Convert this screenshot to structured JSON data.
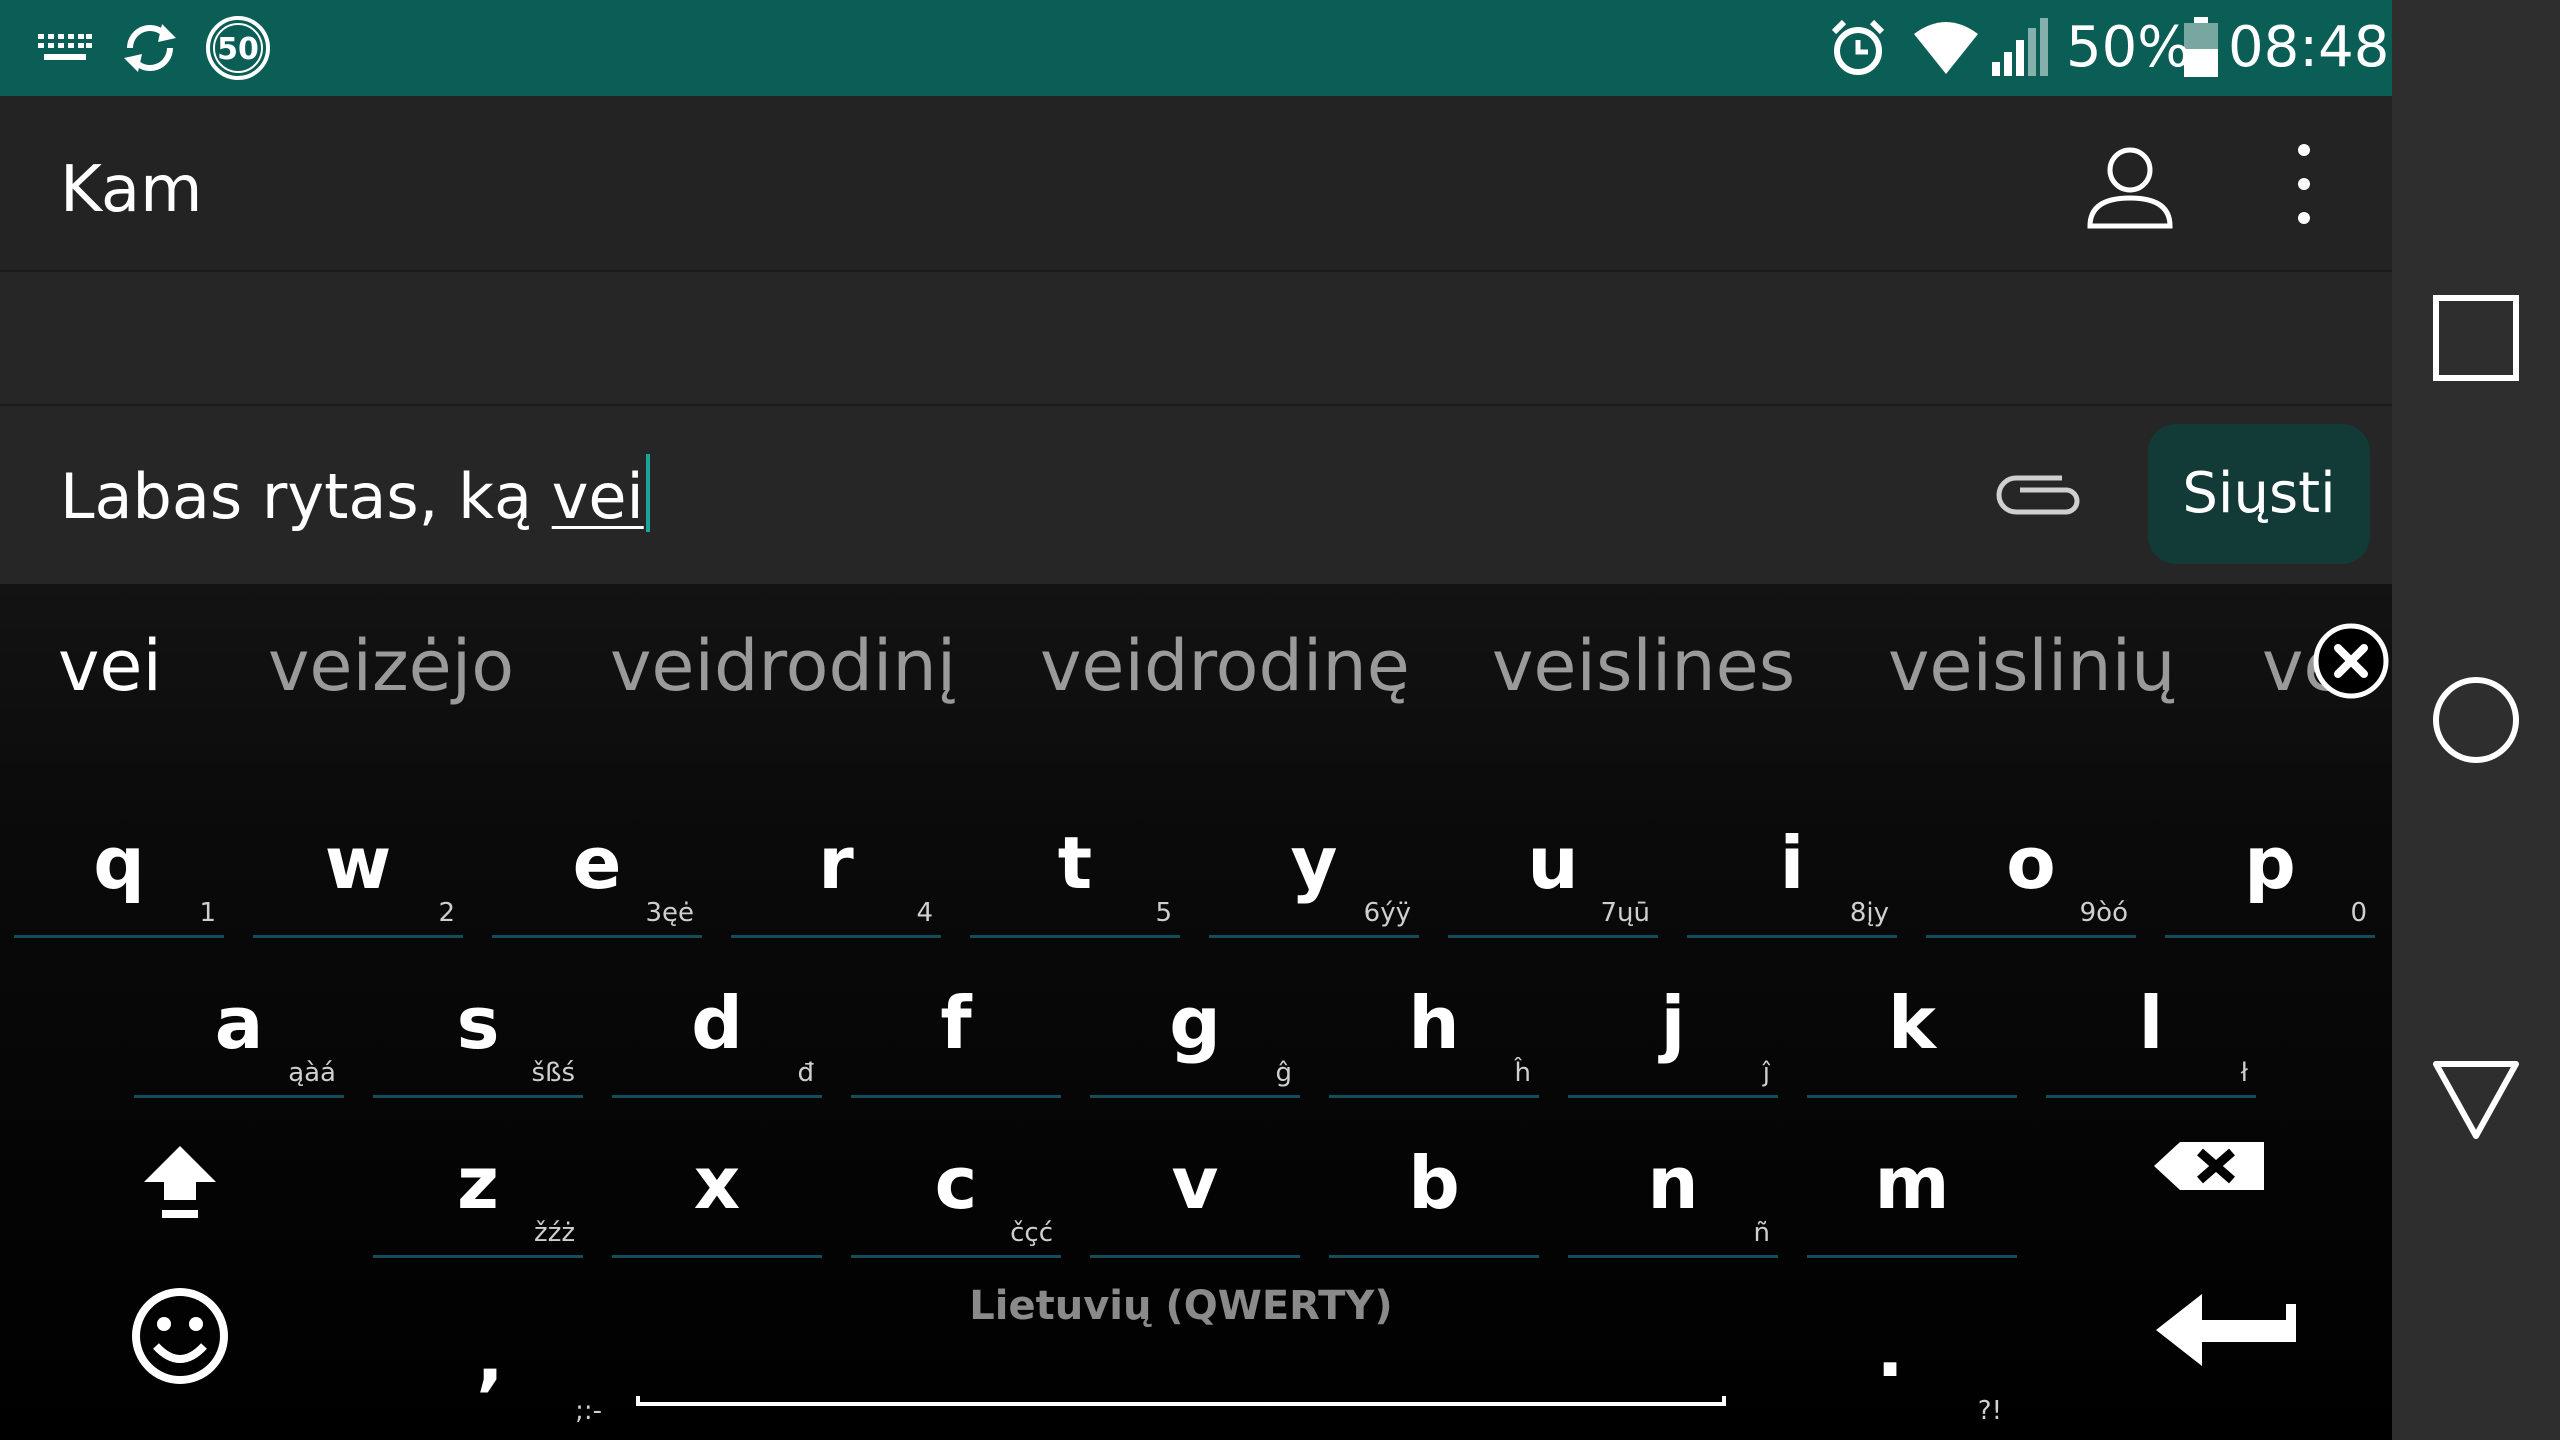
{
  "status_bar": {
    "icons": [
      "keyboard-icon",
      "sync-icon",
      "speed-limit-icon",
      "alarm-icon",
      "wifi-icon",
      "signal-icon",
      "battery-icon"
    ],
    "speed_limit": "50",
    "battery_percent": "50%",
    "time": "08:48"
  },
  "header": {
    "title": "Kam",
    "icons": [
      "contact-icon",
      "more-vert-icon"
    ]
  },
  "composer": {
    "text_prefix": "Labas rytas, ką ",
    "text_word": "vei",
    "send_label": "Siųsti",
    "icons": [
      "attach-icon"
    ]
  },
  "suggestions": [
    "vei",
    "veizėjo",
    "veidrodinį",
    "veidrodinę",
    "veislines",
    "veislinių",
    "ve"
  ],
  "keyboard": {
    "row1": [
      {
        "key": "q",
        "sub": "1"
      },
      {
        "key": "w",
        "sub": "2"
      },
      {
        "key": "e",
        "sub": "3ęė"
      },
      {
        "key": "r",
        "sub": "4"
      },
      {
        "key": "t",
        "sub": "5"
      },
      {
        "key": "y",
        "sub": "6ýÿ"
      },
      {
        "key": "u",
        "sub": "7ųū"
      },
      {
        "key": "i",
        "sub": "8įy"
      },
      {
        "key": "o",
        "sub": "9òó"
      },
      {
        "key": "p",
        "sub": "0"
      }
    ],
    "row2": [
      {
        "key": "a",
        "sub": "ąàá"
      },
      {
        "key": "s",
        "sub": "šßś"
      },
      {
        "key": "d",
        "sub": "đ"
      },
      {
        "key": "f",
        "sub": ""
      },
      {
        "key": "g",
        "sub": "ĝ"
      },
      {
        "key": "h",
        "sub": "ĥ"
      },
      {
        "key": "j",
        "sub": "ĵ"
      },
      {
        "key": "k",
        "sub": ""
      },
      {
        "key": "l",
        "sub": "ł"
      }
    ],
    "row3": [
      {
        "key": "z",
        "sub": "žźż"
      },
      {
        "key": "x",
        "sub": ""
      },
      {
        "key": "c",
        "sub": "čçć"
      },
      {
        "key": "v",
        "sub": ""
      },
      {
        "key": "b",
        "sub": ""
      },
      {
        "key": "n",
        "sub": "ñ"
      },
      {
        "key": "m",
        "sub": ""
      }
    ],
    "comma": {
      "key": ",",
      "sub": ";:-"
    },
    "period": {
      "key": ".",
      "sub": "?!"
    },
    "language": "Lietuvių (QWERTY)",
    "icons": [
      "shift-icon",
      "backspace-icon",
      "emoji-icon",
      "enter-icon",
      "close-suggestion-icon"
    ]
  },
  "nav_bar": {
    "icons": [
      "recents-icon",
      "home-icon",
      "back-icon"
    ]
  },
  "colors": {
    "status_bar": "#0a5e55",
    "accent": "#1aa59a",
    "send_button": "#123a37",
    "key_underline": "#124d5c"
  }
}
